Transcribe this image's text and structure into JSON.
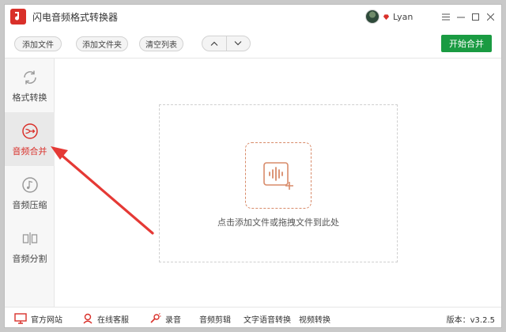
{
  "app": {
    "title": "闪电音频格式转换器",
    "username": "Lyan"
  },
  "toolbar": {
    "add_file": "添加文件",
    "add_folder": "添加文件夹",
    "clear_list": "清空列表",
    "start_merge": "开始合并"
  },
  "sidebar": {
    "items": [
      {
        "label": "格式转换",
        "icon": "refresh-icon"
      },
      {
        "label": "音频合并",
        "icon": "merge-icon",
        "active": true
      },
      {
        "label": "音频压缩",
        "icon": "music-note-icon"
      },
      {
        "label": "音频分割",
        "icon": "split-icon"
      }
    ]
  },
  "main": {
    "drop_text": "点击添加文件或拖拽文件到此处"
  },
  "statusbar": {
    "website": "官方网站",
    "support": "在线客服",
    "record": "录音",
    "audio_edit": "音频剪辑",
    "tts": "文字语音转换",
    "video_convert": "视频转换",
    "version": "版本：v3.2.5"
  },
  "colors": {
    "accent": "#d9302a",
    "merge_button": "#1a9b42",
    "dropzone_icon": "#d88b6a"
  }
}
